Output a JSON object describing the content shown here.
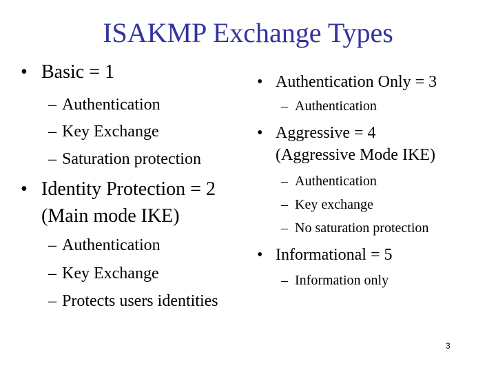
{
  "title": "ISAKMP Exchange Types",
  "left": {
    "basic": {
      "label": "Basic = 1",
      "items": [
        "Authentication",
        "Key Exchange",
        "Saturation protection"
      ]
    },
    "identity": {
      "label_line1": "Identity Protection = 2",
      "label_line2": "(Main mode IKE)",
      "items": [
        "Authentication",
        "Key Exchange",
        "Protects users identities"
      ]
    }
  },
  "right": {
    "auth_only": {
      "label": "Authentication Only = 3",
      "items": [
        "Authentication"
      ]
    },
    "aggressive": {
      "label_line1": "Aggressive = 4",
      "label_line2": "(Aggressive Mode IKE)",
      "items": [
        "Authentication",
        "Key exchange",
        "No saturation protection"
      ]
    },
    "informational": {
      "label": "Informational = 5",
      "items": [
        "Information only"
      ]
    }
  },
  "glyphs": {
    "bullet": "•",
    "dash": "–"
  },
  "page_number": "3",
  "colors": {
    "title": "#3333a0",
    "text": "#000000"
  }
}
